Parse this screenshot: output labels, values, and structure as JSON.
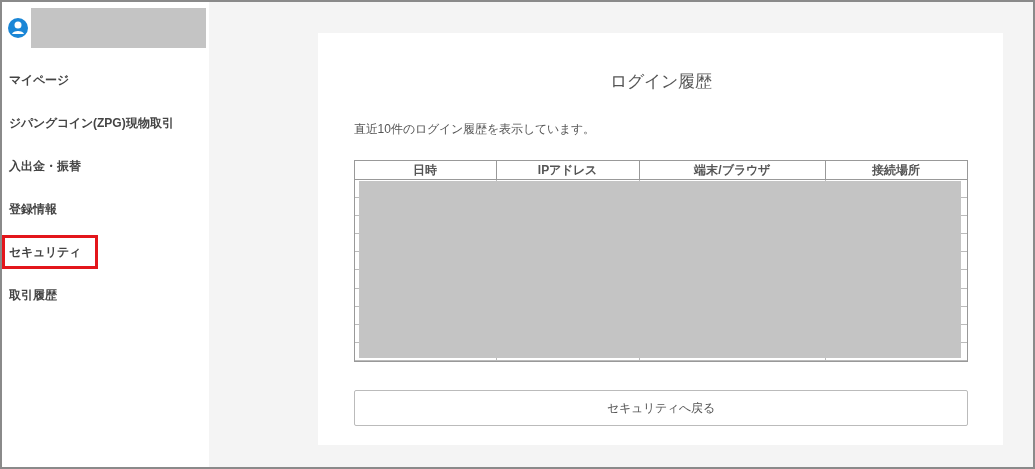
{
  "sidebar": {
    "items": [
      {
        "label": "マイページ",
        "selected": false
      },
      {
        "label": "ジパングコイン(ZPG)現物取引",
        "selected": false
      },
      {
        "label": "入出金・振替",
        "selected": false
      },
      {
        "label": "登録情報",
        "selected": false
      },
      {
        "label": "セキュリティ",
        "selected": true
      },
      {
        "label": "取引履歴",
        "selected": false
      }
    ]
  },
  "main": {
    "title": "ログイン履歴",
    "description": "直近10件のログイン履歴を表示しています。",
    "table": {
      "columns": [
        "日時",
        "IPアドレス",
        "端末/ブラウザ",
        "接続場所"
      ]
    },
    "back_button": "セキュリティへ戻る"
  }
}
